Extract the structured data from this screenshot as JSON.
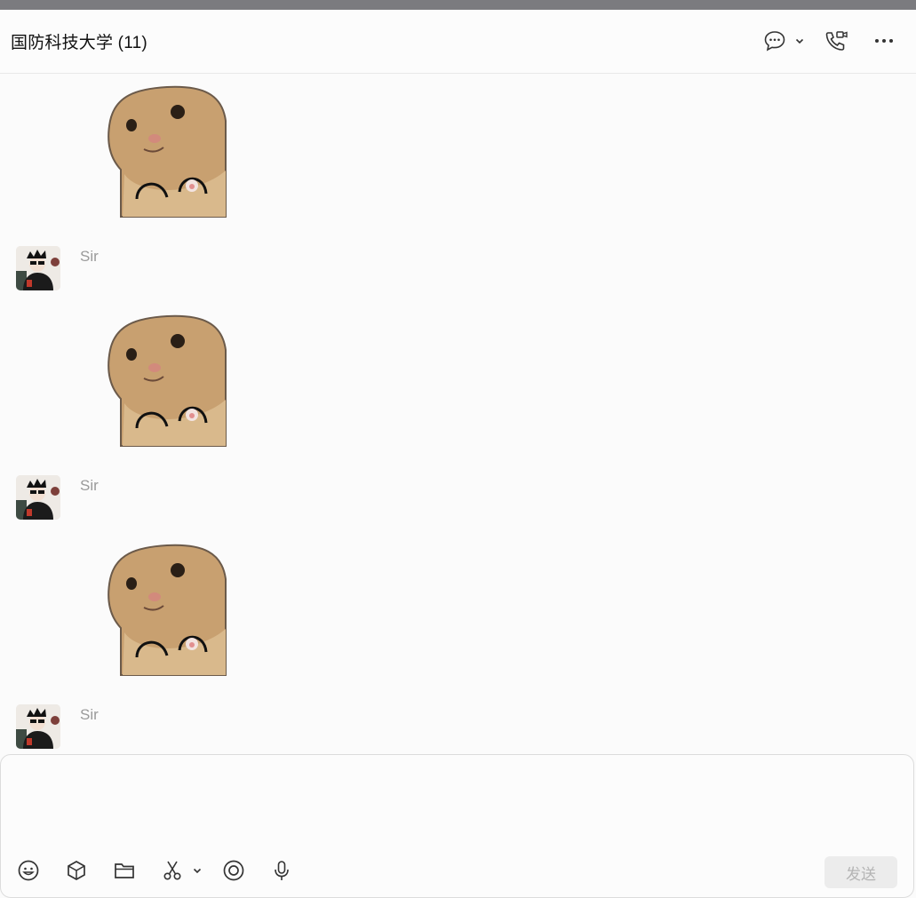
{
  "window": {
    "title": "国防科技大学 (11)"
  },
  "header": {
    "icons": [
      "chat-bubble-icon",
      "chevron-down-icon",
      "phone-video-icon",
      "more-dots-icon"
    ]
  },
  "messages": [
    {
      "type": "sticker",
      "image": "cat-sticker"
    },
    {
      "type": "sender",
      "name": "Sir"
    },
    {
      "type": "sticker",
      "image": "cat-sticker"
    },
    {
      "type": "sender",
      "name": "Sir"
    },
    {
      "type": "sticker",
      "image": "cat-sticker"
    },
    {
      "type": "sender",
      "name": "Sir"
    }
  ],
  "composer": {
    "value": "",
    "tools": [
      "emoji-icon",
      "box-icon",
      "folder-icon",
      "scissors-icon",
      "chevron-down-icon",
      "record-icon",
      "microphone-icon"
    ],
    "send_label": "发送"
  },
  "colors": {
    "topbar": "#7b7b7f",
    "background": "#fbfbfb",
    "sender_name": "#9a9a9a",
    "send_button_bg": "#ececec",
    "send_button_text": "#b4b4b4"
  }
}
